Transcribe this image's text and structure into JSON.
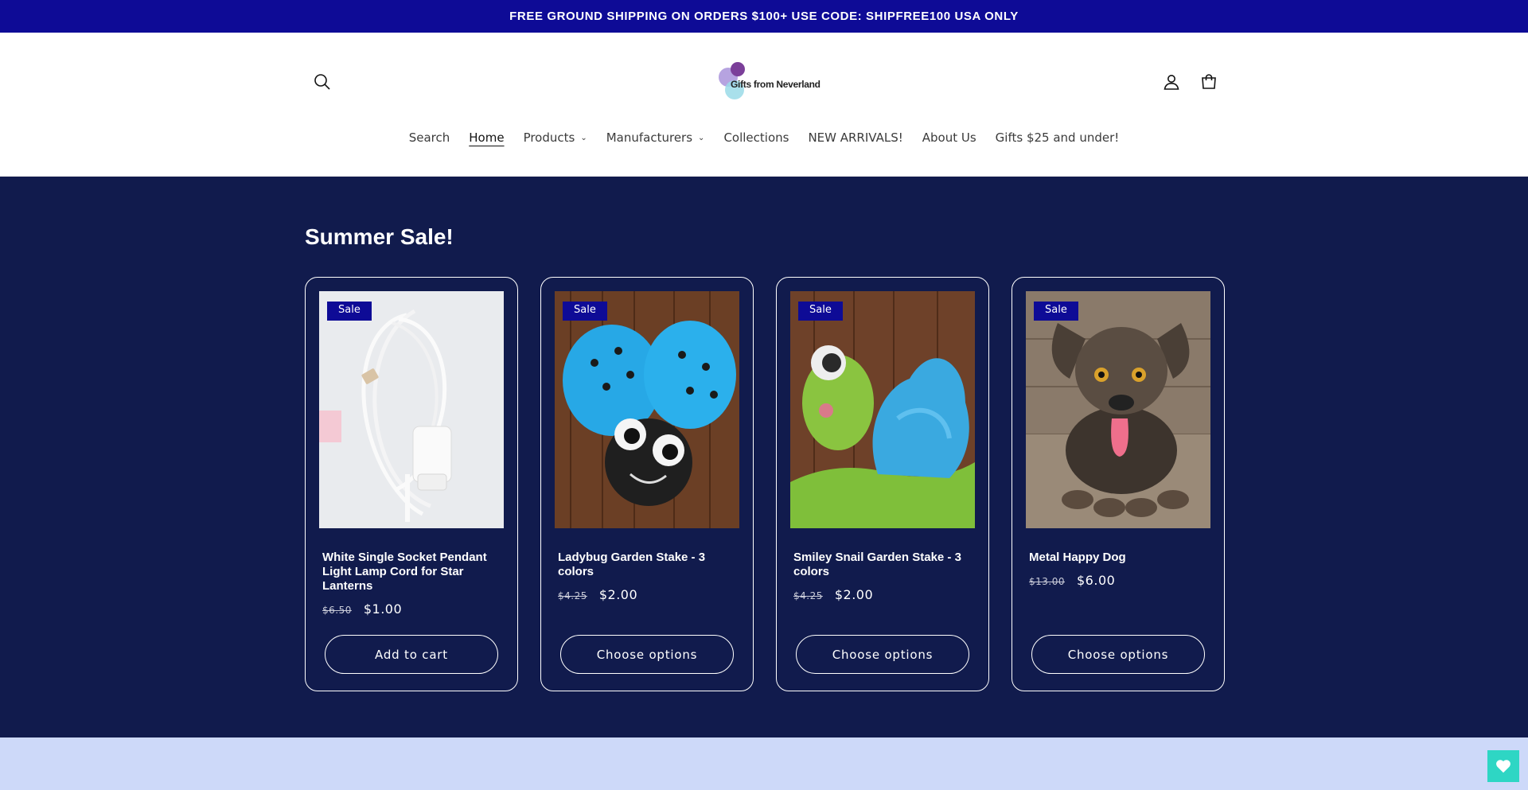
{
  "announcement": {
    "text": "FREE GROUND SHIPPING ON ORDERS $100+ USE CODE: SHIPFREE100 USA ONLY"
  },
  "header": {
    "logo_text": "Gifts from Neverland",
    "icons": {
      "search": "search-icon",
      "account": "account-icon",
      "cart": "cart-icon"
    }
  },
  "nav": {
    "items": [
      {
        "label": "Search"
      },
      {
        "label": "Home"
      },
      {
        "label": "Products"
      },
      {
        "label": "Manufacturers"
      },
      {
        "label": "Collections"
      },
      {
        "label": "NEW ARRIVALS!"
      },
      {
        "label": "About Us"
      },
      {
        "label": "Gifts $25 and under!"
      }
    ]
  },
  "section": {
    "title": "Summer Sale!",
    "products": [
      {
        "badge": "Sale",
        "title": "White Single Socket Pendant Light Lamp Cord for Star Lanterns",
        "price_old": "$6.50",
        "price_new": "$1.00",
        "button": "Add to cart"
      },
      {
        "badge": "Sale",
        "title": "Ladybug Garden Stake - 3 colors",
        "price_old": "$4.25",
        "price_new": "$2.00",
        "button": "Choose options"
      },
      {
        "badge": "Sale",
        "title": "Smiley Snail Garden Stake - 3 colors",
        "price_old": "$4.25",
        "price_new": "$2.00",
        "button": "Choose options"
      },
      {
        "badge": "Sale",
        "title": "Metal Happy Dog",
        "price_old": "$13.00",
        "price_new": "$6.00",
        "button": "Choose options"
      }
    ]
  },
  "colors": {
    "announcement_bg": "#0e0b96",
    "section_bg": "#111b4d",
    "badge_bg": "#0e0b96",
    "lower_bg": "#cdd9f9",
    "wishlist_bg": "#2ed6c4"
  },
  "wishlist": {
    "icon": "heart-icon"
  }
}
